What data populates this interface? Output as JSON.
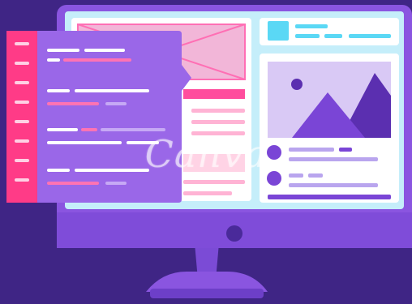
{
  "illustration": {
    "background_color": "#3f2585",
    "monitor": {
      "frame_color": "#8a55e0",
      "screen_color": "#c5eefa",
      "stand_color": "#7b4bd6",
      "power_button_color": "#4a2a9a"
    },
    "browser_window": {
      "left_panel_color": "#ffffff",
      "pink_accent": "#ff4d9d",
      "image_placeholder": {
        "fill": "#f2b6d8",
        "stroke": "#ff6fb4"
      },
      "right_panel_color": "#ffffff",
      "avatar_square_color": "#5ad8f5",
      "picture_card": {
        "sky": "#d9c9f5",
        "sun": "#5b2fb0",
        "mountain_front": "#7a45d6",
        "mountain_back": "#5b2fb0"
      },
      "text_line_color": "#b9a5ee"
    },
    "code_editor": {
      "panel_color": "#9a67e8",
      "gutter_color": "#ff3b87",
      "line_colors": {
        "white": "#ffffff",
        "pink": "#ff73b3",
        "lilac": "#c6a9f5"
      }
    }
  },
  "watermark": {
    "text": "Canva"
  }
}
